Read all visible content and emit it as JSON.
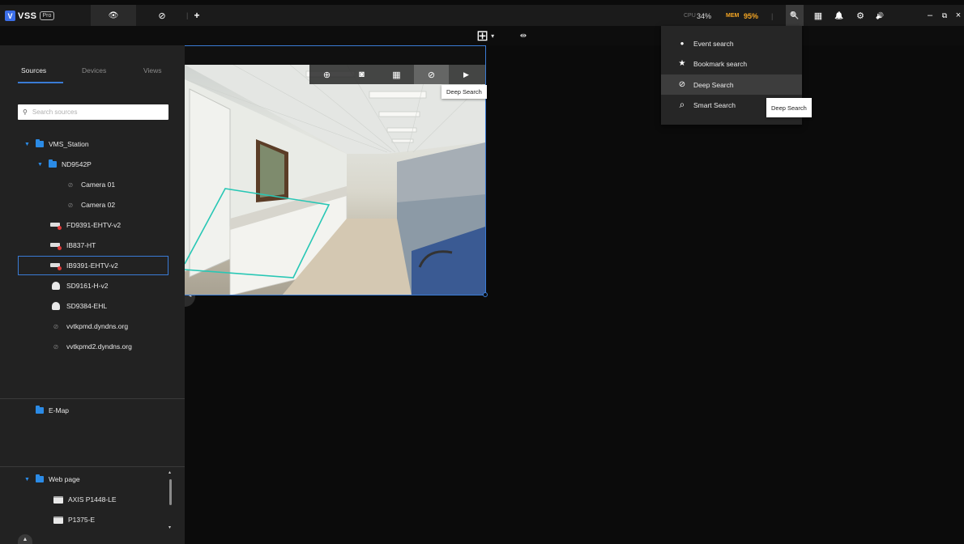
{
  "app": {
    "brand_letter": "V",
    "brand": "VSS",
    "edition": "Pro",
    "tabs": [
      {
        "icon": "eye-icon",
        "glyph": "👁",
        "active": true
      },
      {
        "icon": "deep-search-icon",
        "glyph": "⊘",
        "active": false
      }
    ],
    "add_tab_glyph": "+",
    "separator": "|"
  },
  "system": {
    "cpu_label": "CPU",
    "cpu_value": "34%",
    "mem_label": "MEM",
    "mem_value": "95%",
    "mem_color": "#f5a623",
    "separator": "|",
    "icons": [
      {
        "name": "search-icon",
        "glyph": "🔍"
      },
      {
        "name": "grid-apps-icon",
        "glyph": "▦"
      },
      {
        "name": "bell-icon",
        "glyph": "🔔"
      },
      {
        "name": "settings-gear-icon",
        "glyph": "⚙"
      },
      {
        "name": "volume-icon",
        "glyph": "🔊"
      }
    ],
    "window_controls": [
      {
        "name": "minimize-icon",
        "glyph": "–"
      },
      {
        "name": "restore-icon",
        "glyph": "⧉"
      },
      {
        "name": "close-icon",
        "glyph": "×"
      }
    ]
  },
  "layout_toolbar": {
    "layout_glyph": "⊞",
    "caret_glyph": "▾",
    "ptz_glyph": "⇹"
  },
  "sidebar": {
    "tabs": [
      {
        "label": "Sources",
        "active": true
      },
      {
        "label": "Devices",
        "active": false
      },
      {
        "label": "Views",
        "active": false
      }
    ],
    "search": {
      "placeholder": "Search sources",
      "value": ""
    },
    "tree": [
      {
        "label": "VMS_Station",
        "type": "folder",
        "expanded": true
      },
      {
        "label": "ND9542P",
        "type": "folder",
        "expanded": true
      },
      {
        "label": "Camera 01",
        "type": "camera-offline"
      },
      {
        "label": "Camera 02",
        "type": "camera-offline"
      },
      {
        "label": "FD9391-EHTV-v2",
        "type": "camera-alert"
      },
      {
        "label": "IB837-HT",
        "type": "camera-alert"
      },
      {
        "label": "IB9391-EHTV-v2",
        "type": "camera-alert",
        "selected": true
      },
      {
        "label": "SD9161-H-v2",
        "type": "dome"
      },
      {
        "label": "SD9384-EHL",
        "type": "dome"
      },
      {
        "label": "vvtkpmd.dyndns.org",
        "type": "camera-offline"
      },
      {
        "label": "vvtkpmd2.dyndns.org",
        "type": "camera-offline"
      }
    ],
    "emap_label": "E-Map",
    "web": [
      {
        "label": "Web page",
        "type": "folder",
        "expanded": true
      },
      {
        "label": "AXIS P1448-LE",
        "type": "web"
      },
      {
        "label": "P1375-E",
        "type": "web"
      }
    ],
    "scroll_up_glyph": "▴",
    "scroll_down_glyph": "▾",
    "collapse_glyph": "◂",
    "bottom_glyph": "▲"
  },
  "video_toolbar": {
    "buttons": [
      {
        "name": "zoom-in-icon",
        "glyph": "⊕"
      },
      {
        "name": "snapshot-camera-icon",
        "glyph": "◙"
      },
      {
        "name": "layout-grid-icon",
        "glyph": "▦"
      },
      {
        "name": "deep-search-icon",
        "glyph": "⊘"
      },
      {
        "name": "play-icon",
        "glyph": "▶"
      }
    ],
    "tooltip": "Deep Search"
  },
  "search_menu": {
    "items": [
      {
        "label": "Event search",
        "icon": "event-pin-icon",
        "glyph": "●"
      },
      {
        "label": "Bookmark search",
        "icon": "star-icon",
        "glyph": "★"
      },
      {
        "label": "Deep Search",
        "icon": "deep-search-icon",
        "glyph": "⊘",
        "hover": true
      },
      {
        "label": "Smart Search",
        "icon": "smart-search-icon",
        "glyph": "⌕"
      }
    ],
    "tooltip": "Deep Search"
  }
}
